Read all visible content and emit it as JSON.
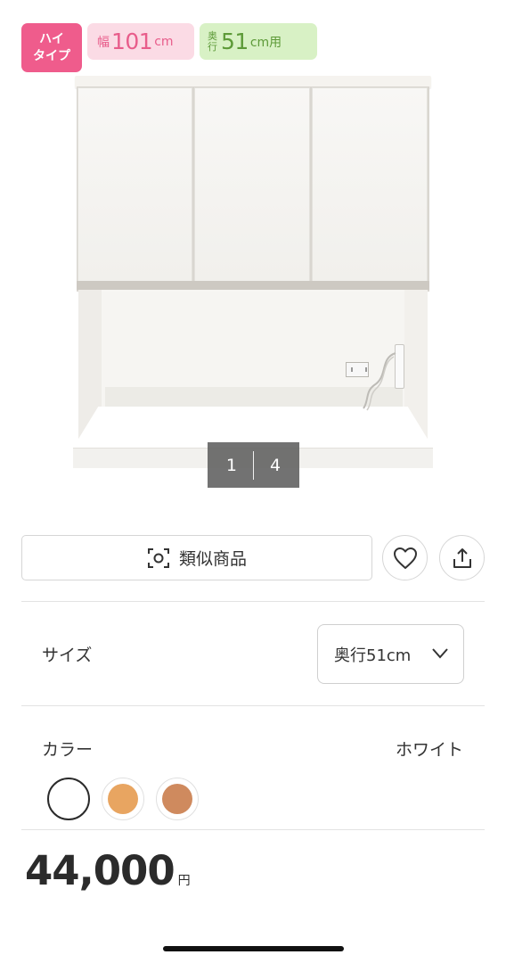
{
  "badges": {
    "type_line1": "ハイ",
    "type_line2": "タイプ",
    "width_prefix": "幅",
    "width_value": "101",
    "width_unit": "cm",
    "depth_prefix_1": "奥",
    "depth_prefix_2": "行",
    "depth_value": "51",
    "depth_unit": "cm用"
  },
  "gallery": {
    "current": "1",
    "total": "4"
  },
  "actions": {
    "similar_label": "類似商品"
  },
  "size": {
    "label": "サイズ",
    "selected": "奥行51cm"
  },
  "color": {
    "label": "カラー",
    "selected_name": "ホワイト",
    "swatches": [
      {
        "color": "#ffffff",
        "selected": true
      },
      {
        "color": "#e8a561",
        "selected": false
      },
      {
        "color": "#cf8a5e",
        "selected": false
      }
    ]
  },
  "price": {
    "amount": "44,000",
    "unit": "円"
  },
  "colors": {
    "badge_pink": "#ef5c8c",
    "badge_width_bg": "#fbdbe5",
    "badge_depth_bg": "#d8f1c5"
  }
}
